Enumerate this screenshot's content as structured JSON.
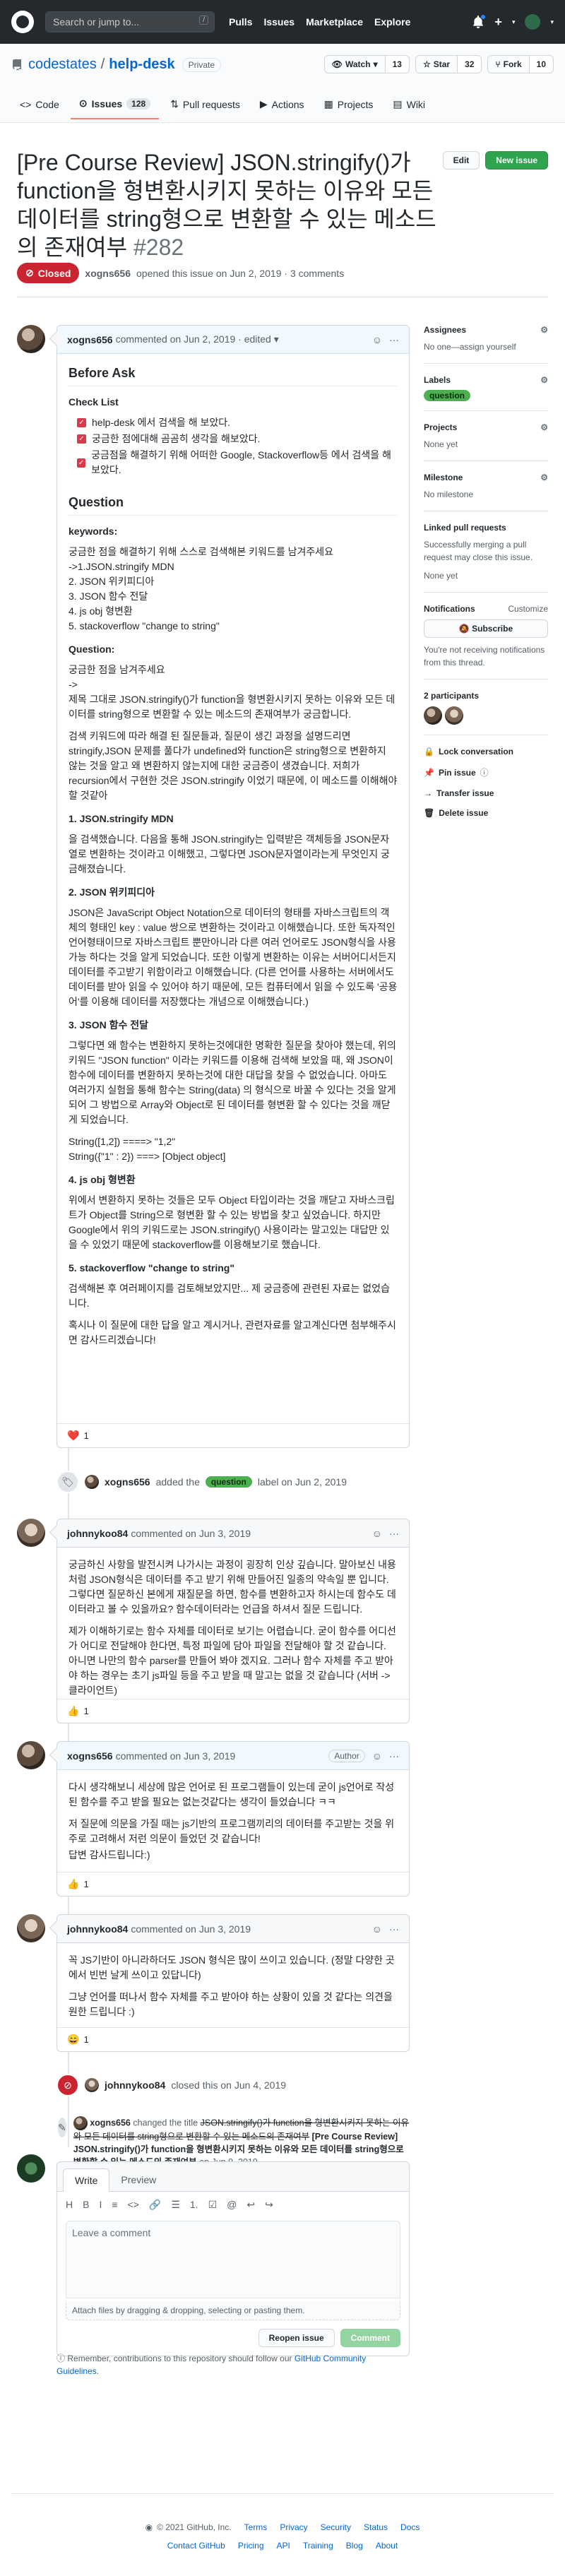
{
  "topbar": {
    "search_placeholder": "Search or jump to...",
    "search_shortcut": "/",
    "nav": [
      "Pulls",
      "Issues",
      "Marketplace",
      "Explore"
    ],
    "plus_icon": "plus-icon"
  },
  "repo": {
    "owner": "codestates",
    "name": "help-desk",
    "visibility": "Private",
    "watch_label": "Watch",
    "watch_count": "13",
    "star_label": "Star",
    "star_count": "32",
    "fork_label": "Fork",
    "fork_count": "10",
    "tabs": [
      {
        "label": "Code"
      },
      {
        "label": "Issues",
        "count": "128"
      },
      {
        "label": "Pull requests"
      },
      {
        "label": "Actions"
      },
      {
        "label": "Projects"
      },
      {
        "label": "Wiki"
      }
    ]
  },
  "issue": {
    "title": "[Pre Course Review] JSON.stringify()가 function을 형변환시키지 못하는 이유와 모든 데이터를 string형으로 변환할 수 있는 메소드의 존재여부",
    "number": "#282",
    "edit_label": "Edit",
    "new_issue_label": "New issue",
    "state": "Closed",
    "author": "xogns656",
    "opened_text": "opened this issue on Jun 2, 2019 · 3 comments"
  },
  "first_comment": {
    "author": "xogns656",
    "meta": "commented on Jun 2, 2019 · edited ▾",
    "h_before": "Before Ask",
    "checklist_title": "Check List",
    "checklist": [
      "help-desk 에서 검색을 해 보았다.",
      "궁금한 점에대해 곰곰히 생각을 해보았다.",
      "궁금점을 해결하기 위해 어떠한 Google, Stackoverflow등 에서 검색을 해보았다."
    ],
    "h_question": "Question",
    "keywords_title": "keywords:",
    "keywords_lines": [
      "궁금한 점을 해결하기 위해 스스로 검색해본 키워드를 남겨주세요",
      "->1.JSON.stringify MDN",
      "2. JSON 위키피디아",
      "3. JSON 함수 전달",
      "4. js obj 형변환",
      "5. stackoverflow \"change to string\""
    ],
    "question_title": "Question:",
    "q_lines": [
      "궁금한 점을 남겨주세요",
      "->",
      "제목 그대로 JSON.stringify()가 function을 형변환시키지 못하는 이유와 모든 데이터를 string형으로 변환할 수 있는 메소드의 존재여부가 궁금합니다."
    ],
    "q_para2": "검색 키워드에 따라 해결 된 질문들과, 질문이 생긴 과정을 설명드리면 stringify,JSON 문제를 풀다가 undefined와 function은 string형으로 변환하지 않는 것을 알고 왜 변환하지 않는지에 대한 궁금증이 생겼습니다. 저희가 recursion에서 구현한 것은 JSON.stringify 이었기 때문에, 이 메소드를 이해해야 할 것같아",
    "s1_title": "1. JSON.stringify MDN",
    "s1_text": "을 검색했습니다. 다음을 통해 JSON.stringify는 입력받은 객체등을 JSON문자열로 변환하는 것이라고 이해했고, 그렇다면 JSON문자열이라는게 무엇인지 궁금해졌습니다.",
    "s2_title": "2. JSON 위키피디아",
    "s2_text": "JSON은 JavaScript Object Notation으로 데이터의 형태를 자바스크립트의 객체의 형태인 key : value 쌍으로 변환하는 것이라고 이해했습니다. 또한 독자적인 언어형태이므로 자바스크립트 뿐만아니라 다른 여러 언어로도 JSON형식을 사용가능 하다는 것을 알게 되었습니다. 또한 이렇게 변환하는 이유는 서버어디서든지 데이터를 주고받기 위함이라고 이해했습니다. (다른 언어를 사용하는 서버에서도 데이터를 받아 읽을 수 있어야 하기 때문에, 모든 컴퓨터에서 읽을 수 있도록 '공용어'를 이용해 데이터를 저장했다는 개념으로 이해했습니다.)",
    "s3_title": "3. JSON 함수 전달",
    "s3_text": "그렇다면 왜 함수는 변환하지 못하는것에대한 명확한 질문을 찾아야 했는데, 위의 키워드 \"JSON function\" 이라는 키워드를 이용해 검색해 보았을 때, 왜 JSON이 함수에 데이터를 변환하지 못하는것에 대한 대답을 찾을 수 없었습니다. 아마도 여러가지 실험을 통해 함수는 String(data) 의 형식으로 바꿀 수 있다는 것을 알게 되어 그 방법으로 Array와 Object로 된 데이터를 형변환 할 수 있다는 것을 깨닫게 되었습니다.",
    "s3_code": [
      "String([1,2]) ====> \"1,2\"",
      "String({\"1\" : 2}) ===> [Object object]"
    ],
    "s4_title": "4. js obj 형변환",
    "s4_text": "위에서 변환하지 못하는 것들은 모두 Object 타입이라는 것을 깨닫고 자바스크립트가 Object를 String으로 형변환 할 수 있는 방법을 찾고 싶었습니다. 하지만 Google에서 위의 키워드로는 JSON.stringify() 사용이라는 말고있는 대답만 있을 수 있었기 때문에 stackoverflow를 이용해보기로 했습니다.",
    "s5_title": "5. stackoverflow \"change to string\"",
    "s5_text": "검색해본 후 여러페이지를 검토해보았지만... 제 궁금증에 관련된 자료는 없었습니다.",
    "closing": "혹시나 이 질문에 대한 답을 알고 계시거나, 관련자료를 알고계신다면 첨부해주시면 감사드리겠습니다!",
    "reaction_emoji": "❤️",
    "reaction_count": "1"
  },
  "label_event": {
    "actor": "xogns656",
    "pre": "added the",
    "label": "question",
    "post": "label on Jun 2, 2019"
  },
  "comment2": {
    "author": "johnnykoo84",
    "meta": "commented on Jun 3, 2019",
    "p1": "궁금하신 사항을 발전시켜 나가시는 과정이 굉장히 인상 깊습니다. 말아보신 내용처럼 JSON형식은 데이터를 주고 받기 위해 만들어진 일종의 약속일 뿐 입니다. 그렇다면 질문하신 본에게 재질문을 하면, 함수를 변환하고자 하시는데 함수도 데이터라고 볼 수 있을까요? 함수데이터라는 언급을 하셔서 질문 드립니다.",
    "p2": "제가 이해하기로는 함수 자체를 데이터로 보기는 어렵습니다. 굳이 함수를 어디선가 어디로 전달해야 한다면, 특정 파일에 담아 파일을 전달해야 할 것 같습니다. 아니면 나만의 함수 parser를 만들어 봐야 겠지요. 그러나 함수 자체를 주고 받아야 하는 경우는 초기 js파일 등을 주고 받을 때 말고는 없을 것 같습니다 (서버 -> 클라이언트)",
    "reaction_emoji": "👍",
    "reaction_count": "1"
  },
  "comment3": {
    "author": "xogns656",
    "meta": "commented on Jun 3, 2019",
    "role": "Author",
    "p1": "다시 생각해보니 세상에 많은 언어로 된 프로그램들이 있는데 굳이 js언어로 작성된 함수를 주고 받을 필요는 없는것같다는 생각이 들었습니다 ㅋㅋ",
    "p2": "저 질문에 의문을 가질 때는 js기반의 프로그램끼리의 데이터를 주고받는 것을 위주로 고려해서 저런 의문이 들었던 것 같습니다!",
    "p3": "답변 감사드립니다:)",
    "reaction_emoji": "👍",
    "reaction_count": "1"
  },
  "comment4": {
    "author": "johnnykoo84",
    "meta": "commented on Jun 3, 2019",
    "p1": "꼭 JS기반이 아니라하더도 JSON 형식은 많이 쓰이고 있습니다. (정말 다양한 곳에서 빈번 날게 쓰이고 있답니다)",
    "p2": "그냥 언어를 떠나서 함수 자체를 주고 받아야 하는 상황이 있을 것 같다는 의견을 원한 드립니다 :)",
    "reaction_emoji": "😄",
    "reaction_count": "1"
  },
  "closed_event": {
    "actor": "johnnykoo84",
    "text": "closed this on Jun 4, 2019"
  },
  "rename_event": {
    "actor": "xogns656",
    "pre": "changed the title",
    "old_title": "JSON.stringify()가 function을 형변환시키지 못하는 이유와 모든 데이터를 string형으로 변환할 수 있는 메소드의 존재여부",
    "new_title": "[Pre Course Review] JSON.stringify()가 function을 형변환시키지 못하는 이유와 모든 데이터를 string형으로 변환할 수 있는 메소드의 존재여부",
    "post": "on Jun 9, 2019"
  },
  "editor": {
    "tab_write": "Write",
    "tab_preview": "Preview",
    "placeholder": "Leave a comment",
    "attach": "Attach files by dragging & dropping, selecting or pasting them.",
    "reopen": "Reopen issue",
    "comment": "Comment",
    "tools": [
      "H",
      "B",
      "I",
      "≡",
      "<>",
      "🔗",
      "☰",
      "1.",
      "☑",
      "@",
      "↩",
      "↪"
    ]
  },
  "note": {
    "pre": "Remember, contributions to this repository should follow our",
    "link": "GitHub Community Guidelines",
    "post": "."
  },
  "sidebar": {
    "assignees_title": "Assignees",
    "assignees_value": "No one—assign yourself",
    "labels_title": "Labels",
    "labels_value": "question",
    "projects_title": "Projects",
    "projects_value": "None yet",
    "milestone_title": "Milestone",
    "milestone_value": "No milestone",
    "linked_title": "Linked pull requests",
    "linked_desc": "Successfully merging a pull request may close this issue.",
    "linked_value": "None yet",
    "notifications_title": "Notifications",
    "notifications_customize": "Customize",
    "subscribe": "Subscribe",
    "notifications_note": "You're not receiving notifications from this thread.",
    "participants_title": "2 participants",
    "lock": "Lock conversation",
    "pin": "Pin issue",
    "transfer": "Transfer issue",
    "delete": "Delete issue"
  },
  "footer": {
    "copyright": "© 2021 GitHub, Inc.",
    "row1": [
      "Terms",
      "Privacy",
      "Security",
      "Status",
      "Docs"
    ],
    "row2": [
      "Contact GitHub",
      "Pricing",
      "API",
      "Training",
      "Blog",
      "About"
    ]
  },
  "colors": {
    "accent_blue": "#0366d6",
    "closed_red": "#cb2431",
    "header_dark": "#24292e",
    "label_question": "#4caf50"
  }
}
